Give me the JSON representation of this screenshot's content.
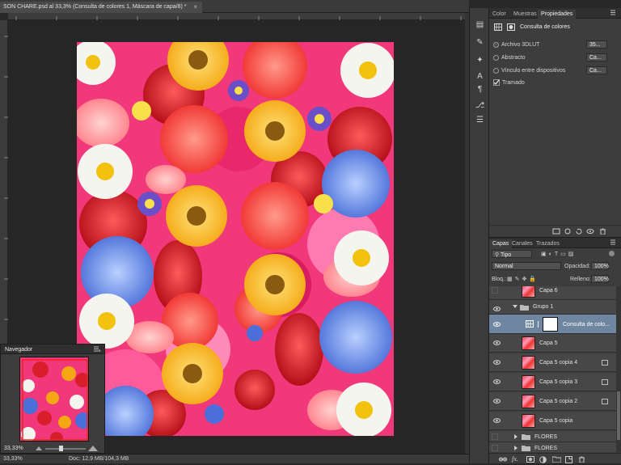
{
  "document": {
    "tab_title": "SON CHARE.psd al 33,3% (Consulta de colores 1, Máscara de capa/8) *",
    "close_glyph": "×",
    "status_doc": "Doc: 12,9 MB/104,3 MB",
    "zoom": "33,33%"
  },
  "props_panel": {
    "tabs": [
      "Color",
      "Muestras",
      "Propiedades"
    ],
    "active_tab": "Propiedades",
    "title": "Consulta de colores",
    "options": [
      {
        "label": "Archivo 3DLUT",
        "value": "35..."
      },
      {
        "label": "Abstracto",
        "value": "Ca..."
      },
      {
        "label": "Vínculo entre dispositivos",
        "value": "Ca..."
      }
    ],
    "dither_label": "Tramado"
  },
  "layers_panel": {
    "tabs": [
      "Capas",
      "Canales",
      "Trazados"
    ],
    "filter_label": "Tipo",
    "blend_mode": "Normal",
    "opacity_label": "Opacidad:",
    "opacity_value": "100%",
    "lock_label": "Bloq.:",
    "fill_label": "Relleno:",
    "fill_value": "100%",
    "layers": [
      {
        "name": "Capa 6",
        "visible": false
      },
      {
        "name": "Grupo 1",
        "visible": true
      },
      {
        "name": "Consulta de colo...",
        "visible": true
      },
      {
        "name": "Capa 5",
        "visible": true
      },
      {
        "name": "Capa 5 copia 4",
        "visible": true
      },
      {
        "name": "Capa 5 copia 3",
        "visible": true
      },
      {
        "name": "Capa 5 copia 2",
        "visible": true
      },
      {
        "name": "Capa 5 copia",
        "visible": true
      },
      {
        "name": "FLORES",
        "visible": false
      },
      {
        "name": "FLORES",
        "visible": false
      }
    ]
  },
  "navigator": {
    "title": "Navegador"
  },
  "colors": {
    "panel_bg": "#3d3d3d",
    "selected_layer": "#6f86a0",
    "canvas_bg": "#262626"
  },
  "icons": [
    "close-icon",
    "eye-icon",
    "folder-icon",
    "adjustment-icon",
    "mask-icon",
    "smart-object-icon",
    "zoom-out-icon",
    "zoom-in-icon",
    "menu-icon",
    "link-icon",
    "fx-icon",
    "new-layer-icon",
    "trash-icon"
  ]
}
